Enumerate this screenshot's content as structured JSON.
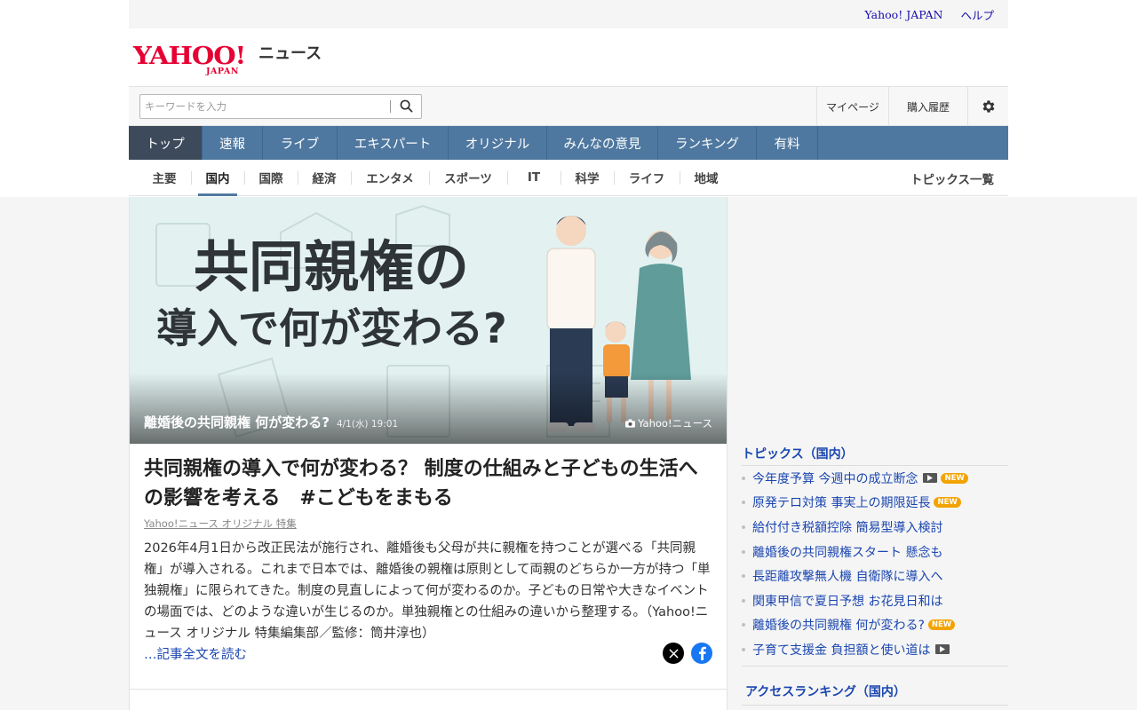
{
  "util": {
    "links": [
      "Yahoo! JAPAN",
      "ヘルプ"
    ]
  },
  "logo": {
    "yahoo": "YAHOO!",
    "japan": "JAPAN",
    "service": "ニュース"
  },
  "search": {
    "placeholder": "キーワードを入力",
    "value": ""
  },
  "header_links": {
    "mypage": "マイページ",
    "history": "購入履歴"
  },
  "nav": {
    "items": [
      "トップ",
      "速報",
      "ライブ",
      "エキスパート",
      "オリジナル",
      "みんなの意見",
      "ランキング",
      "有料"
    ],
    "active": "トップ"
  },
  "subnav": {
    "items": [
      "主要",
      "国内",
      "国際",
      "経済",
      "エンタメ",
      "スポーツ",
      "IT",
      "科学",
      "ライフ",
      "地域"
    ],
    "active": "国内",
    "topics_all": "トピックス一覧"
  },
  "hero": {
    "graphic_line1": "共同親権の",
    "graphic_line2": "導入で何が変わる?",
    "caption_title": "離婚後の共同親権 何が変わる?",
    "caption_date": "4/1(水) 19:01",
    "credit": "Yahoo!ニュース"
  },
  "article": {
    "headline": "共同親権の導入で何が変わる？ 制度の仕組みと子どもの生活への影響を考える　#こどもをまもる",
    "byline": "Yahoo!ニュース オリジナル 特集",
    "summary": "2026年4月1日から改正民法が施行され、離婚後も父母が共に親権を持つことが選べる「共同親権」が導入される。これまで日本では、離婚後の親権は原則として両親のどちらか一方が持つ「単独親権」に限られてきた。制度の見直しによって何が変わるのか。子どもの日常や大きなイベントの場面では、どのような違いが生じるのか。単独親権との仕組みの違いから整理する。（Yahoo!ニュース オリジナル 特集編集部／監修：筒井淳也）",
    "read_more": "…記事全文を読む"
  },
  "topics": {
    "heading": "トピックス（国内）",
    "new_label": "NEW",
    "items": [
      {
        "title": "今年度予算 今週中の成立断念",
        "video": true,
        "new": true
      },
      {
        "title": "原発テロ対策 事実上の期限延長",
        "video": false,
        "new": true
      },
      {
        "title": "給付付き税額控除 簡易型導入検討",
        "video": false,
        "new": false
      },
      {
        "title": "離婚後の共同親権スタート 懸念も",
        "video": false,
        "new": false
      },
      {
        "title": "長距離攻撃無人機 自衛隊に導入へ",
        "video": false,
        "new": false
      },
      {
        "title": "関東甲信で夏日予想 お花見日和は",
        "video": false,
        "new": false
      },
      {
        "title": "離婚後の共同親権 何が変わる?",
        "video": false,
        "new": true
      },
      {
        "title": "子育て支援金 負担額と使い道は",
        "video": true,
        "new": false
      }
    ]
  },
  "ranking": {
    "heading": "アクセスランキング（国内）"
  },
  "colors": {
    "nav_bg": "#4f78a0",
    "nav_active": "#3d4a5c",
    "link": "#1a46b0",
    "brand_red": "#e60033",
    "new_badge": "#f2a300"
  }
}
